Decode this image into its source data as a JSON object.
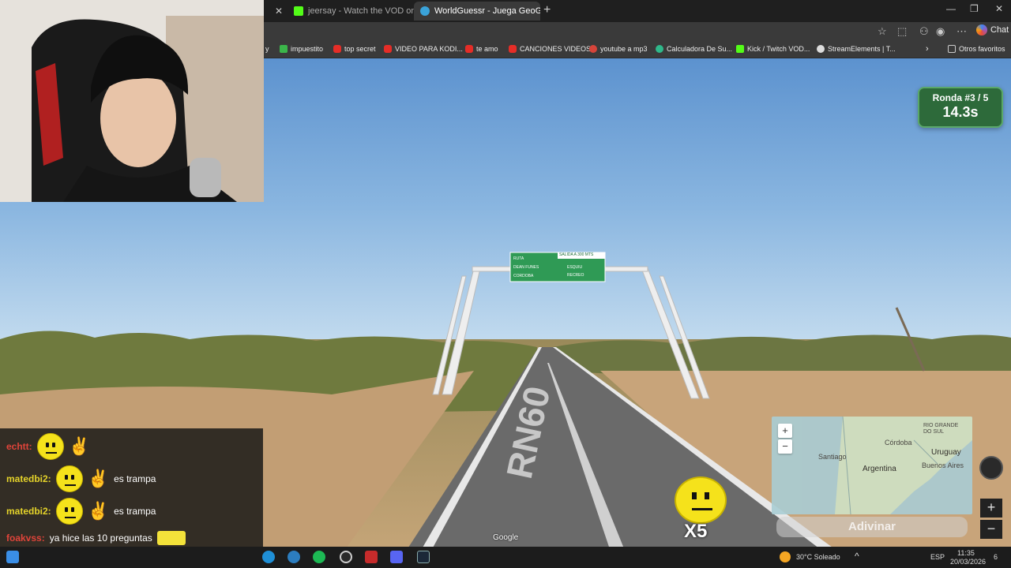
{
  "browser": {
    "tabs": [
      {
        "label": "jeersay - Watch the VOD on Kick",
        "active": false
      },
      {
        "label": "WorldGuessr - Juega GeoGuessr g",
        "active": true
      }
    ],
    "new_tab": "+",
    "window_controls": {
      "minimize": "—",
      "maximize": "❐",
      "close": "✕"
    },
    "chat_label": "Chat",
    "bookmarks": [
      "y",
      "impuestito",
      "top secret",
      "VIDEO PARA KODI...",
      "te amo",
      "CANCIONES VIDEOS",
      "youtube a mp3",
      "Calculadora De Su...",
      "Kick / Twitch VOD...",
      "StreamElements | T..."
    ],
    "other_favorites": "Otros favoritos"
  },
  "game": {
    "round_label": "Ronda #3 / 5",
    "timer": "14.3s",
    "guess_button": "Adivinar",
    "map_zoom_in": "+",
    "map_zoom_out": "−",
    "view_zoom_in": "+",
    "view_zoom_out": "−",
    "map_labels": {
      "rio_grande": "RIO GRANDE\nDO SUL",
      "cordoba": "Córdoba",
      "uruguay": "Uruguay",
      "santiago": "Santiago",
      "argentina": "Argentina",
      "buenos_aires": "Buenos Aires"
    },
    "road_marking": "RN60",
    "attribution": "Google",
    "sign": {
      "left_lines": [
        "RUTA",
        "DEAN FUNES",
        "CORDOBA"
      ],
      "right_header": "SALIDA A 300 MTS",
      "right_lines": [
        "ESQUIU",
        "RECREO"
      ]
    },
    "overlay_multiplier": "X5"
  },
  "chat": {
    "messages": [
      {
        "user": "echtt:",
        "text": "",
        "user_color": "#e0443a"
      },
      {
        "user": "matedbi2:",
        "text": "es trampa",
        "user_color": "#e5d32a"
      },
      {
        "user": "matedbi2:",
        "text": "es trampa",
        "user_color": "#e5d32a"
      },
      {
        "user": "foakvss:",
        "text": "ya hice las 10 preguntas",
        "user_color": "#e0443a"
      }
    ]
  },
  "taskbar": {
    "weather": "30°C  Soleado",
    "language": "ESP",
    "time": "11:35",
    "date": "20/03/2026",
    "notifications": "6"
  },
  "colors": {
    "round_bg": "#2d6a3a",
    "sign_green": "#2f9a55",
    "sky_top": "#4a84c8"
  }
}
